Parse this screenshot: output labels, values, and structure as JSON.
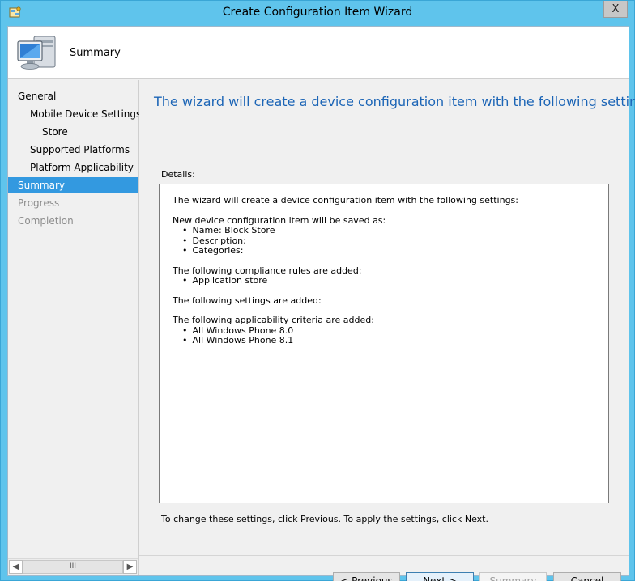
{
  "window": {
    "title": "Create Configuration Item Wizard",
    "close_glyph": "X",
    "app_icon": "wizard-app-icon"
  },
  "header": {
    "title": "Summary",
    "icon": "computer-monitor-icon"
  },
  "nav": {
    "items": [
      {
        "label": "General",
        "state": "normal"
      },
      {
        "label": "Mobile Device Settings",
        "state": "normal"
      },
      {
        "label": "Store",
        "state": "normal"
      },
      {
        "label": "Supported Platforms",
        "state": "normal"
      },
      {
        "label": "Platform Applicability",
        "state": "normal"
      },
      {
        "label": "Summary",
        "state": "selected"
      },
      {
        "label": "Progress",
        "state": "disabled"
      },
      {
        "label": "Completion",
        "state": "disabled"
      }
    ],
    "scroll_thumb": "III"
  },
  "content": {
    "title": "The wizard will create a device configuration item with the following settings",
    "details_label": "Details:",
    "details": {
      "intro": "The wizard will create a device configuration item with the following settings:",
      "saved_as_heading": "New device configuration item will be saved as:",
      "saved_as_items": [
        "Name: Block Store",
        "Description:",
        "Categories:"
      ],
      "compliance_heading": "The following compliance rules are added:",
      "compliance_items": [
        "Application store"
      ],
      "settings_heading": "The following settings are added:",
      "applicability_heading": "The following applicability criteria are added:",
      "applicability_items": [
        "All Windows Phone 8.0",
        "All Windows Phone 8.1"
      ]
    },
    "hint": "To change these settings, click Previous. To apply the settings, click Next."
  },
  "buttons": {
    "previous": "< Previous",
    "next": "Next >",
    "summary": "Summary",
    "cancel": "Cancel"
  },
  "colors": {
    "titlebar": "#5fc4ec",
    "accent_title": "#1c65b6",
    "selected_nav": "#3399e0"
  }
}
